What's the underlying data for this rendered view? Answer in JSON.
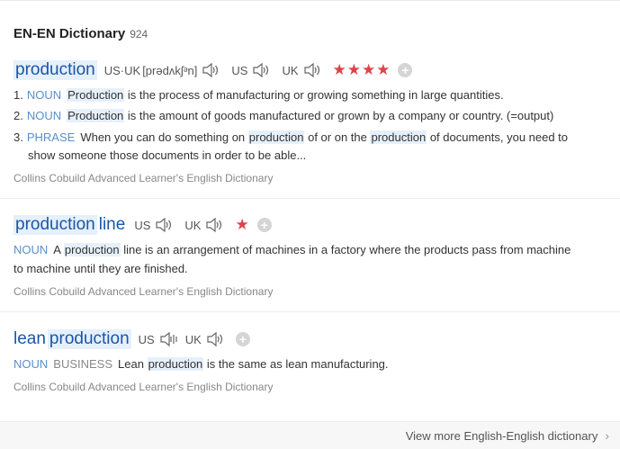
{
  "header": {
    "title": "EN-EN Dictionary",
    "count": "924"
  },
  "entries": [
    {
      "headword_parts": [
        "production"
      ],
      "pron_us_uk_label": "US·UK",
      "ipa": "[prədʌkʃᵊn]",
      "us_label": "US",
      "uk_label": "UK",
      "stars": "★★★★",
      "plus": "+",
      "defs": [
        {
          "num": "1.",
          "pos": "NOUN",
          "kw": "Production",
          "text": " is the process of manufacturing or growing something in large quantities."
        },
        {
          "num": "2.",
          "pos": "NOUN",
          "kw": "Production",
          "text": " is the amount of goods manufactured or grown by a company or country. (=output)"
        },
        {
          "num": "3.",
          "pos": "PHRASE",
          "pre": "When you can do something on ",
          "kw": "production",
          "mid": " of or on the ",
          "kw2": "production",
          "text": " of documents, you need to",
          "cont": "show someone those documents in order to be able..."
        }
      ],
      "source": "Collins Cobuild Advanced Learner's English Dictionary"
    },
    {
      "headword_parts": [
        "production",
        "line"
      ],
      "us_label": "US",
      "uk_label": "UK",
      "stars": "★",
      "plus": "+",
      "defs": [
        {
          "pos": "NOUN",
          "pre": "A ",
          "kw": "production",
          "text": " line is an arrangement of machines in a factory where the products pass from machine",
          "cont": "to machine until they are finished."
        }
      ],
      "source": "Collins Cobuild Advanced Learner's English Dictionary"
    },
    {
      "headword_parts": [
        "lean",
        "production"
      ],
      "us_label": "US",
      "uk_label": "UK",
      "plus": "+",
      "defs": [
        {
          "pos": "NOUN",
          "pos2": "BUSINESS",
          "pre": "Lean ",
          "kw": "production",
          "text": " is the same as lean manufacturing."
        }
      ],
      "source": "Collins Cobuild Advanced Learner's English Dictionary"
    }
  ],
  "footer": {
    "more_label": "View more English-English dictionary",
    "chevron": "›"
  },
  "icons": {
    "speaker": "speaker-icon",
    "add": "add-icon",
    "chevron": "chevron-right-icon"
  },
  "colors": {
    "link": "#1a56a8",
    "pos": "#5b8fc7",
    "highlight": "#e6f0fb",
    "star": "#e0424b"
  }
}
